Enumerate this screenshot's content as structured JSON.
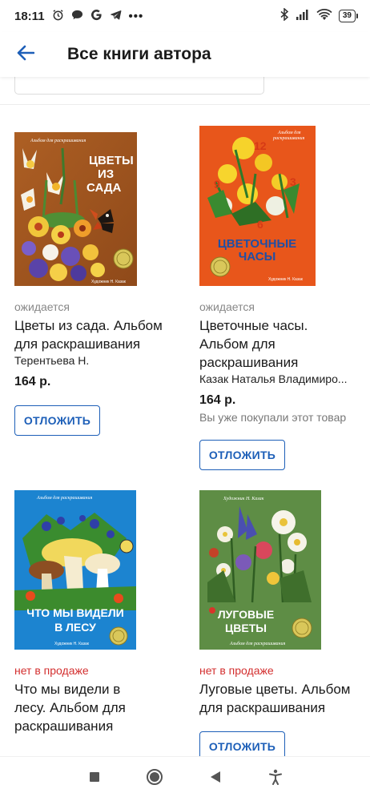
{
  "status_bar": {
    "time": "18:11",
    "battery": "39"
  },
  "header": {
    "title": "Все книги автора"
  },
  "books": [
    {
      "status": "ожидается",
      "title": "Цветы из сада. Альбом для раскрашивания",
      "author": "Терентьева Н.",
      "price": "164 р.",
      "note": "",
      "button": "ОТЛОЖИТЬ",
      "cover": {
        "top": "Альбом для раскрашивания",
        "t1": "ЦВЕТЫ",
        "t2": "ИЗ",
        "t3": "САДА",
        "artist": "Художник Н. Казак"
      }
    },
    {
      "status": "ожидается",
      "title": "Цветочные часы. Альбом для раскрашивания",
      "author": "Казак Наталья Владимиро...",
      "price": "164 р.",
      "note": "Вы уже покупали этот товар",
      "button": "ОТЛОЖИТЬ",
      "cover": {
        "top1": "Альбом для",
        "top2": "раскрашивания",
        "t1": "ЦВЕТОЧНЫЕ",
        "t2": "ЧАСЫ",
        "artist": "Художник Н. Казак",
        "n12": "12",
        "n3": "3",
        "n6": "6",
        "n9": "9"
      }
    },
    {
      "status": "нет в продаже",
      "title": "Что мы видели в лесу. Альбом для раскрашивания",
      "author": "",
      "price": "",
      "note": "",
      "button": "",
      "cover": {
        "top": "Альбом для раскрашивания",
        "t1": "ЧТО МЫ ВИДЕЛИ",
        "t2": "В ЛЕСУ",
        "artist": "Художник Н. Казак"
      }
    },
    {
      "status": "нет в продаже",
      "title": "Луговые цветы. Альбом для раскрашивания",
      "author": "",
      "price": "",
      "note": "",
      "button": "ОТЛОЖИТЬ",
      "cover": {
        "top": "Художник Н. Казак",
        "t1": "ЛУГОВЫЕ",
        "t2": "ЦВЕТЫ",
        "bottom": "Альбом для раскрашивания"
      }
    }
  ],
  "colors": {
    "accent": "#1d5fb8",
    "unavailable": "#d32f2f"
  },
  "icons": {
    "back": "arrow-left-icon",
    "nav_recents": "square-icon",
    "nav_home": "circle-icon",
    "nav_back": "triangle-back-icon",
    "nav_accessibility": "accessibility-icon"
  }
}
